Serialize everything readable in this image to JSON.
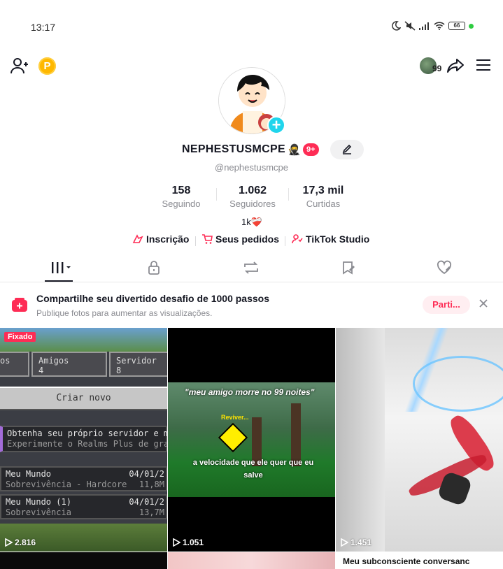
{
  "status_bar": {
    "time": "13:17",
    "battery": "66"
  },
  "header": {
    "coin_label": "P",
    "avatar_badge": "99"
  },
  "profile": {
    "username": "NEPHESTUSMCPE",
    "emoji": "🥷",
    "badge": "9+",
    "handle": "@nephestusmcpe",
    "stats": [
      {
        "value": "158",
        "label": "Seguindo"
      },
      {
        "value": "1.062",
        "label": "Seguidores"
      },
      {
        "value": "17,3 mil",
        "label": "Curtidas"
      }
    ],
    "reaction": "1k❤️‍🩹",
    "links": [
      {
        "label": "Inscrição",
        "icon": "subscription-icon"
      },
      {
        "label": "Seus pedidos",
        "icon": "cart-icon"
      },
      {
        "label": "TikTok Studio",
        "icon": "studio-icon"
      }
    ]
  },
  "tabs": [
    {
      "name": "videos",
      "icon": "grid-icon",
      "active": true
    },
    {
      "name": "private",
      "icon": "lock-icon"
    },
    {
      "name": "reposts",
      "icon": "repost-icon"
    },
    {
      "name": "favorites",
      "icon": "bookmark-icon"
    },
    {
      "name": "liked",
      "icon": "heart-icon"
    }
  ],
  "banner": {
    "title": "Compartilhe seu divertido desafio de 1000 passos",
    "subtitle": "Publique fotos para aumentar as visualizações.",
    "button": "Parti...",
    "accent": "#fe2c55"
  },
  "videos": [
    {
      "pinned": "Fixado",
      "views": "2.816",
      "mc": {
        "tab1": "os",
        "tab2": "Amigos",
        "tab2_count": "4",
        "tab3": "Servidor",
        "tab3_count": "8",
        "button": "Criar novo",
        "promo_title": "Obtenha seu próprio servidor e ma",
        "promo_sub": "Experimente o Realms Plus de graç",
        "world1_name": "Meu Mundo",
        "world1_date": "04/01/2",
        "world1_mode": "Sobrevivência - Hardcore",
        "world1_size": "11,8M",
        "world2_name": "Meu Mundo (1)",
        "world2_date": "04/01/2",
        "world2_mode": "Sobrevivência",
        "world2_size": "13,7M"
      }
    },
    {
      "views": "1.051",
      "caption_top": "\"meu amigo morre no 99 noites\"",
      "reviver": "Reviver...",
      "caption_bottom": "a velocidade que ele quer que eu salve"
    },
    {
      "views": "1.451"
    }
  ],
  "row2": {
    "caption": "Meu subconsciente conversanc"
  }
}
